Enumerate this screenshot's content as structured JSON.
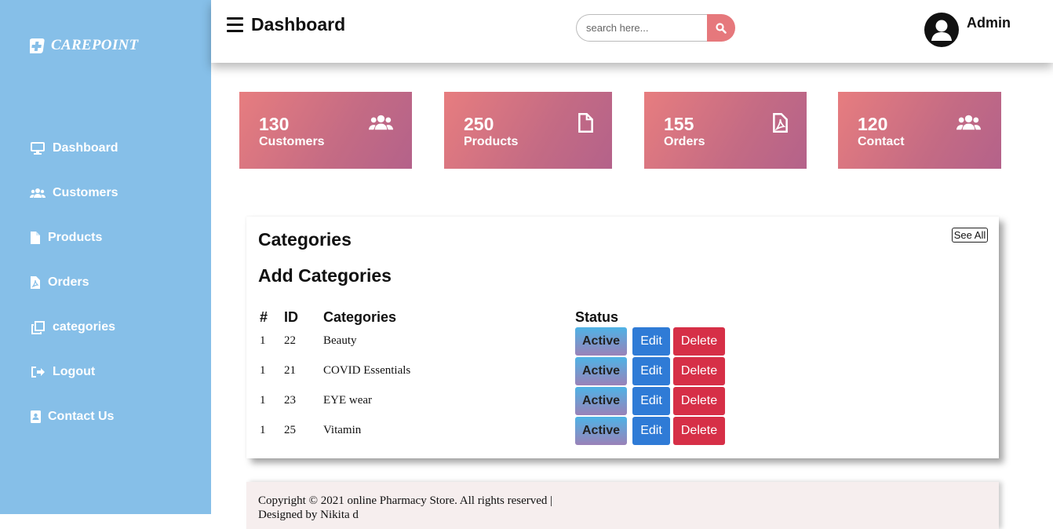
{
  "brand": {
    "name": "CAREPOINT"
  },
  "sidebar": {
    "items": [
      {
        "label": "Dashboard",
        "icon": "desktop-icon"
      },
      {
        "label": "Customers",
        "icon": "users-icon"
      },
      {
        "label": "Products",
        "icon": "file-icon"
      },
      {
        "label": "Orders",
        "icon": "file-pdf-icon"
      },
      {
        "label": "categories",
        "icon": "clone-icon"
      },
      {
        "label": "Logout",
        "icon": "sign-out-icon"
      },
      {
        "label": "Contact Us",
        "icon": "address-card-icon"
      }
    ]
  },
  "header": {
    "title": "Dashboard",
    "search_placeholder": "search here...",
    "user_name": "Admin"
  },
  "cards": [
    {
      "value": "130",
      "label": "Customers",
      "icon": "users-icon"
    },
    {
      "value": "250",
      "label": "Products",
      "icon": "file-icon"
    },
    {
      "value": "155",
      "label": "Orders",
      "icon": "file-pdf-icon"
    },
    {
      "value": "120",
      "label": "Contact",
      "icon": "users-icon"
    }
  ],
  "categories": {
    "title": "Categories",
    "subtitle": "Add Categories",
    "see_all": "See All",
    "columns": [
      "#",
      "ID",
      "Categories",
      "Status"
    ],
    "rows": [
      {
        "num": "1",
        "id": "22",
        "name": "Beauty",
        "status": "Active",
        "edit": "Edit",
        "delete": "Delete"
      },
      {
        "num": "1",
        "id": "21",
        "name": "COVID Essentials",
        "status": "Active",
        "edit": "Edit",
        "delete": "Delete"
      },
      {
        "num": "1",
        "id": "23",
        "name": "EYE wear",
        "status": "Active",
        "edit": "Edit",
        "delete": "Delete"
      },
      {
        "num": "1",
        "id": "25",
        "name": "Vitamin",
        "status": "Active",
        "edit": "Edit",
        "delete": "Delete"
      }
    ]
  },
  "footer": {
    "copyright": "Copyright © 2021 online Pharmacy Store. All rights reserved |",
    "designed_by": "Designed by Nikita d"
  },
  "colors": {
    "sidebar": "#86bfe8",
    "card_gradient_start": "#e77d7f",
    "card_gradient_end": "#b4628a",
    "search_button": "#e6787c",
    "edit_button": "#2f7bd6",
    "delete_button": "#d62f47"
  }
}
